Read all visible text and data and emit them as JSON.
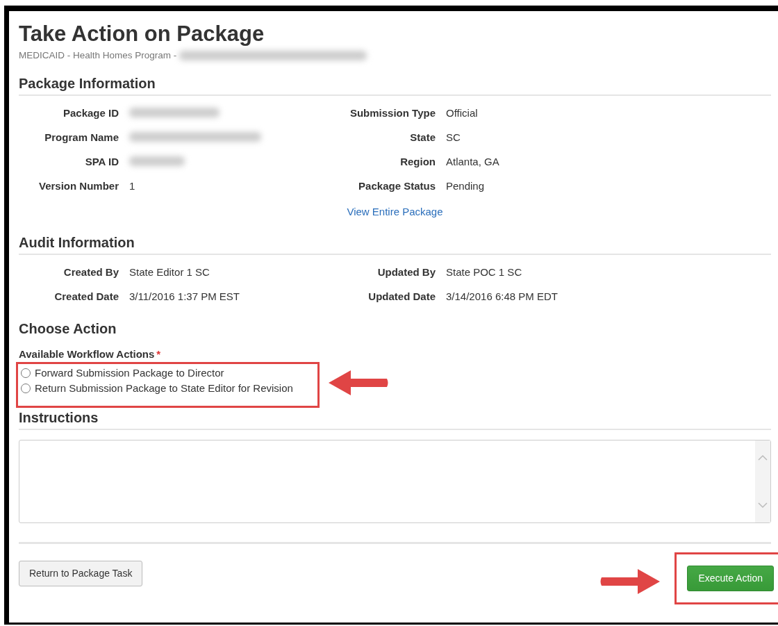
{
  "page": {
    "title": "Take Action on Package",
    "subtitle": "MEDICAID - Health Homes Program -",
    "subtitle_redacted": true
  },
  "sections": [
    {
      "kind": "details",
      "heading": "Package Information",
      "left": [
        {
          "label": "Package ID",
          "redacted": true
        },
        {
          "label": "Program Name",
          "redacted": true
        },
        {
          "label": "SPA ID",
          "redacted": true
        },
        {
          "label": "Version Number",
          "value": "1",
          "redacted": false
        }
      ],
      "right": [
        {
          "label": "Submission Type",
          "value": "Official",
          "redacted": false
        },
        {
          "label": "State",
          "value": "SC",
          "redacted": false
        },
        {
          "label": "Region",
          "value": "Atlanta, GA",
          "redacted": false
        },
        {
          "label": "Package Status",
          "value": "Pending",
          "redacted": false
        }
      ],
      "link": "View Entire Package"
    },
    {
      "kind": "details",
      "heading": "Audit Information",
      "left": [
        {
          "label": "Created By",
          "value": "State Editor 1 SC",
          "redacted": false
        },
        {
          "label": "Created Date",
          "value": "3/11/2016 1:37 PM EST",
          "redacted": false
        }
      ],
      "right": [
        {
          "label": "Updated By",
          "value": "State POC 1 SC",
          "redacted": false
        },
        {
          "label": "Updated Date",
          "value": "3/14/2016 6:48 PM EDT",
          "redacted": false
        }
      ]
    },
    {
      "kind": "actions",
      "heading": "Choose Action",
      "field_label": "Available Workflow Actions",
      "required_mark": "*",
      "highlighted": true,
      "options": [
        {
          "label": "Forward Submission Package to Director",
          "selected": false
        },
        {
          "label": "Return Submission Package to State Editor for Revision",
          "selected": false
        }
      ]
    },
    {
      "kind": "instructions",
      "heading": "Instructions"
    }
  ],
  "buttons": {
    "back": {
      "label": "Return to Package Task"
    },
    "execute": {
      "label": "Execute Action",
      "highlighted": true
    }
  }
}
